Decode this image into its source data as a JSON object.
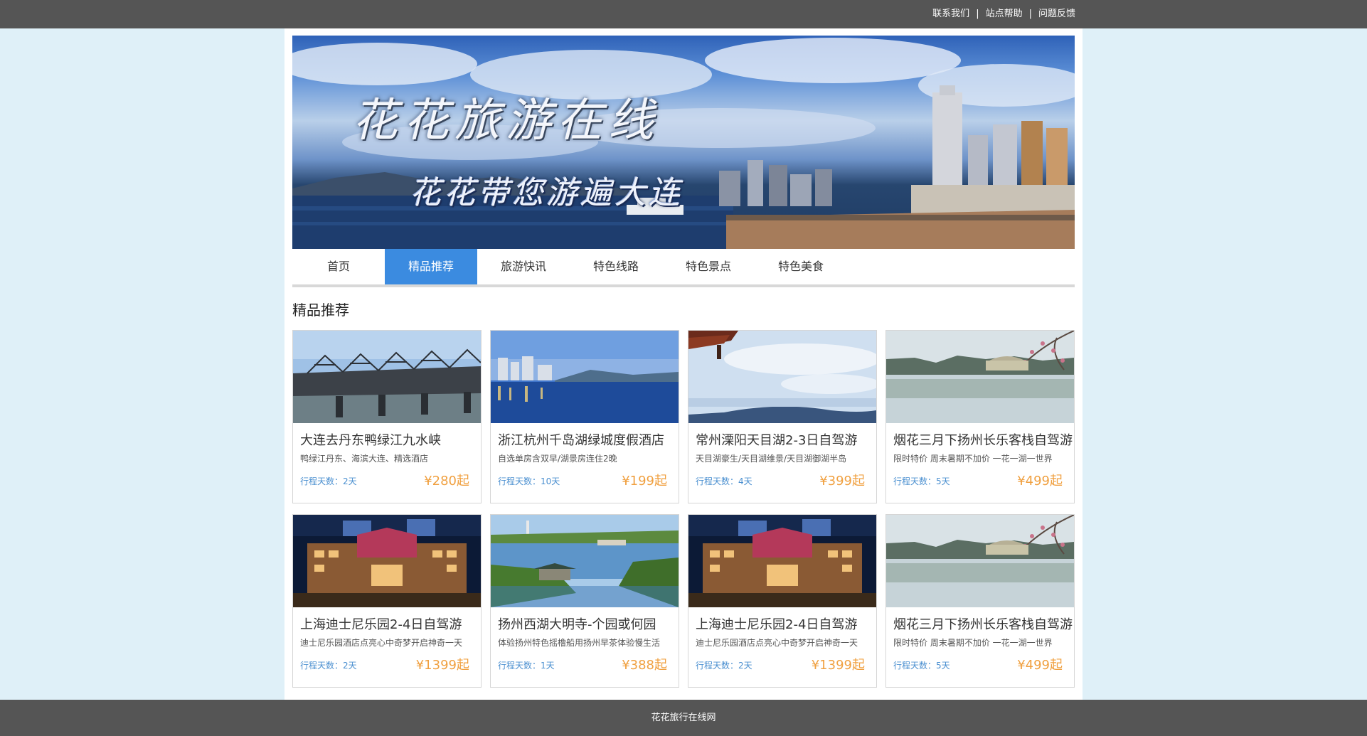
{
  "top_links": [
    "联系我们",
    "站点帮助",
    "问题反馈"
  ],
  "banner": {
    "title": "花花旅游在线",
    "subtitle": "花花带您游遍大连"
  },
  "nav": {
    "items": [
      "首页",
      "精品推荐",
      "旅游快讯",
      "特色线路",
      "特色景点",
      "特色美食"
    ],
    "active": "精品推荐"
  },
  "section_title": "精品推荐",
  "cards": [
    {
      "title": "大连去丹东鸭绿江九水峡",
      "desc": "鸭绿江丹东、海滨大连、精选酒店",
      "days": "行程天数：2天",
      "price": "¥280起",
      "image": "bridge"
    },
    {
      "title": "浙江杭州千岛湖绿城度假酒店",
      "desc": "自选单房含双早/湖景房连住2晚",
      "days": "行程天数：10天",
      "price": "¥199起",
      "image": "lake-city"
    },
    {
      "title": "常州溧阳天目湖2-3日自驾游",
      "desc": "天目湖豪生/天目湖维景/天目湖御湖半岛",
      "days": "行程天数：4天",
      "price": "¥399起",
      "image": "pavilion-lake"
    },
    {
      "title": "烟花三月下扬州长乐客栈自驾游",
      "desc": "限时特价 周末暑期不加价 一花一湖一世界",
      "days": "行程天数：5天",
      "price": "¥499起",
      "image": "blossom-bridge"
    },
    {
      "title": "上海迪士尼乐园2-4日自驾游",
      "desc": "迪士尼乐园酒店点亮心中奇梦开启神奇一天",
      "days": "行程天数：2天",
      "price": "¥1399起",
      "image": "night-hotel"
    },
    {
      "title": "扬州西湖大明寺-个园或何园",
      "desc": "体验扬州特色摇橹船用扬州早茶体验慢生活",
      "days": "行程天数：1天",
      "price": "¥388起",
      "image": "garden-lake"
    },
    {
      "title": "上海迪士尼乐园2-4日自驾游",
      "desc": "迪士尼乐园酒店点亮心中奇梦开启神奇一天",
      "days": "行程天数：2天",
      "price": "¥1399起",
      "image": "night-hotel"
    },
    {
      "title": "烟花三月下扬州长乐客栈自驾游",
      "desc": "限时特价 周末暑期不加价 一花一湖一世界",
      "days": "行程天数：5天",
      "price": "¥499起",
      "image": "blossom-bridge"
    }
  ],
  "footer": "花花旅行在线网",
  "colors": {
    "accent": "#3b8be0",
    "price": "#f0a040",
    "days": "#4a8fd0",
    "bar": "#555555"
  }
}
